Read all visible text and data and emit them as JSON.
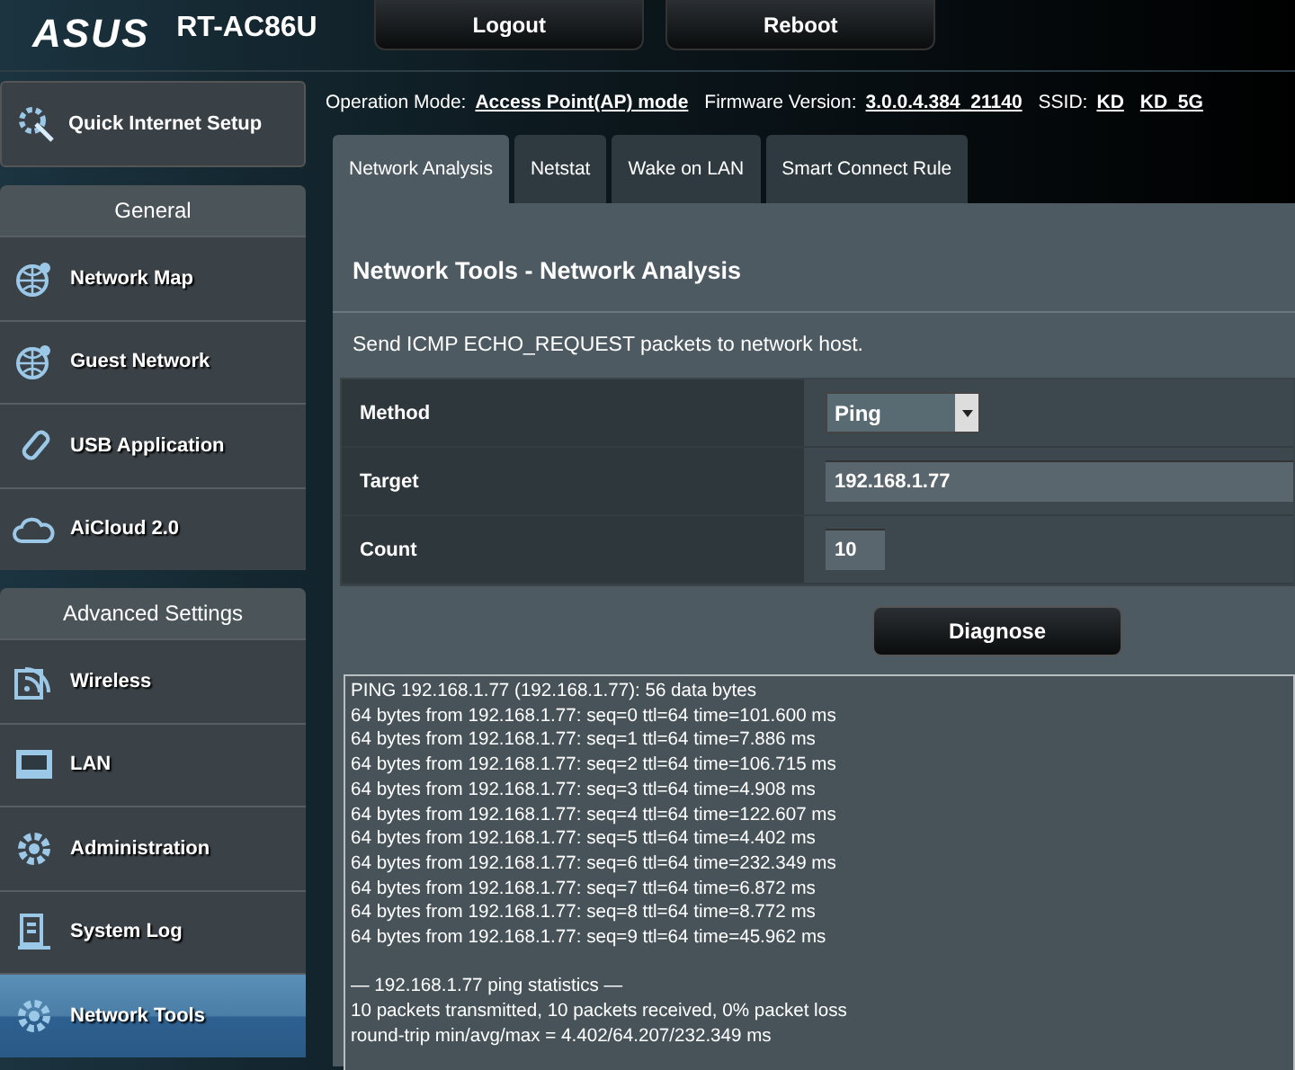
{
  "header": {
    "logo": "ASUS",
    "model": "RT-AC86U",
    "buttons": [
      "Logout",
      "Reboot"
    ]
  },
  "sidebar": {
    "quick_setup": "Quick Internet Setup",
    "groups": [
      {
        "title": "General",
        "items": [
          {
            "label": "Network Map",
            "kind": "globe-pin",
            "selected": false
          },
          {
            "label": "Guest Network",
            "kind": "globe-person",
            "selected": false
          },
          {
            "label": "USB Application",
            "kind": "usb",
            "selected": false
          },
          {
            "label": "AiCloud 2.0",
            "kind": "cloud",
            "selected": false
          }
        ]
      },
      {
        "title": "Advanced Settings",
        "items": [
          {
            "label": "Wireless",
            "kind": "wifi",
            "selected": false
          },
          {
            "label": "LAN",
            "kind": "lan",
            "selected": false
          },
          {
            "label": "Administration",
            "kind": "gear-wrench",
            "selected": false
          },
          {
            "label": "System Log",
            "kind": "log",
            "selected": false
          },
          {
            "label": "Network Tools",
            "kind": "gear",
            "selected": true
          }
        ]
      }
    ]
  },
  "info_bar": {
    "operation_mode_label": "Operation Mode:",
    "operation_mode": "Access Point(AP) mode",
    "firmware_label": "Firmware Version:",
    "firmware": "3.0.0.4.384_21140",
    "ssid_label": "SSID:",
    "ssids": [
      "KD",
      "KD_5G"
    ]
  },
  "tabs": [
    {
      "label": "Network Analysis",
      "selected": true
    },
    {
      "label": "Netstat",
      "selected": false
    },
    {
      "label": "Wake on LAN",
      "selected": false
    },
    {
      "label": "Smart Connect Rule",
      "selected": false
    }
  ],
  "panel": {
    "title": "Network Tools - Network Analysis",
    "description": "Send ICMP ECHO_REQUEST packets to network host.",
    "fields": [
      {
        "label": "Method",
        "kind": "select",
        "value": "Ping"
      },
      {
        "label": "Target",
        "kind": "wide",
        "value": "192.168.1.77"
      },
      {
        "label": "Count",
        "kind": "short",
        "value": "10"
      }
    ],
    "action": "Diagnose",
    "output": [
      "PING 192.168.1.77 (192.168.1.77): 56 data bytes",
      "64 bytes from 192.168.1.77: seq=0 ttl=64 time=101.600 ms",
      "64 bytes from 192.168.1.77: seq=1 ttl=64 time=7.886 ms",
      "64 bytes from 192.168.1.77: seq=2 ttl=64 time=106.715 ms",
      "64 bytes from 192.168.1.77: seq=3 ttl=64 time=4.908 ms",
      "64 bytes from 192.168.1.77: seq=4 ttl=64 time=122.607 ms",
      "64 bytes from 192.168.1.77: seq=5 ttl=64 time=4.402 ms",
      "64 bytes from 192.168.1.77: seq=6 ttl=64 time=232.349 ms",
      "64 bytes from 192.168.1.77: seq=7 ttl=64 time=6.872 ms",
      "64 bytes from 192.168.1.77: seq=8 ttl=64 time=8.772 ms",
      "64 bytes from 192.168.1.77: seq=9 ttl=64 time=45.962 ms"
    ],
    "statistics": [
      "— 192.168.1.77 ping statistics —",
      "10 packets transmitted, 10 packets received, 0% packet loss",
      "round-trip min/avg/max = 4.402/64.207/232.349 ms"
    ]
  }
}
